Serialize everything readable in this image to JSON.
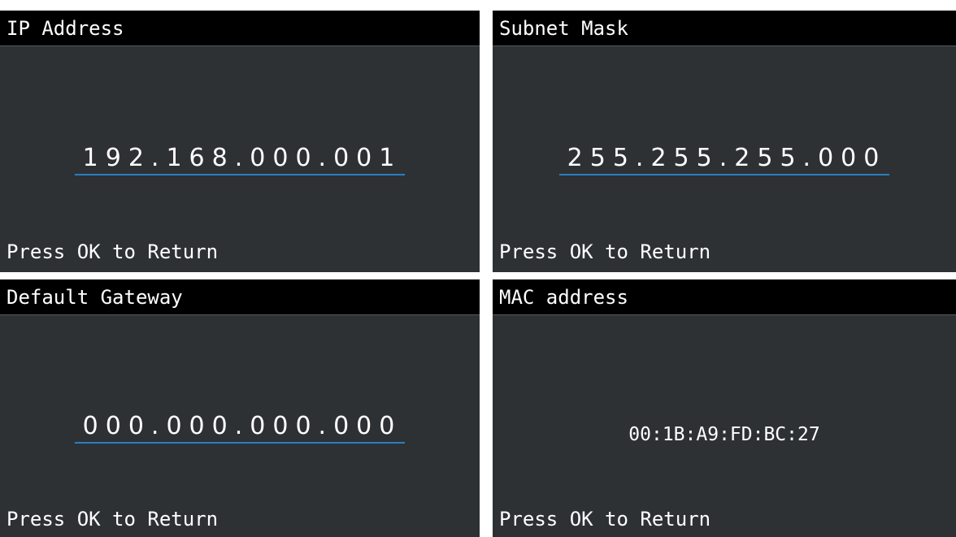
{
  "panels": {
    "ip": {
      "title": "IP Address",
      "value": "192.168.000.001",
      "footer": "Press OK to Return"
    },
    "subnet": {
      "title": "Subnet Mask",
      "value": "255.255.255.000",
      "footer": "Press OK to Return"
    },
    "gateway": {
      "title": "Default Gateway",
      "value": "000.000.000.000",
      "footer": "Press OK to Return"
    },
    "mac": {
      "title": "MAC address",
      "value": "00:1B:A9:FD:BC:27",
      "footer": "Press OK to Return"
    }
  },
  "colors": {
    "panel_background": "#2e3134",
    "title_bar": "#000000",
    "underline_accent": "#2a7fc0",
    "text": "#ffffff"
  }
}
